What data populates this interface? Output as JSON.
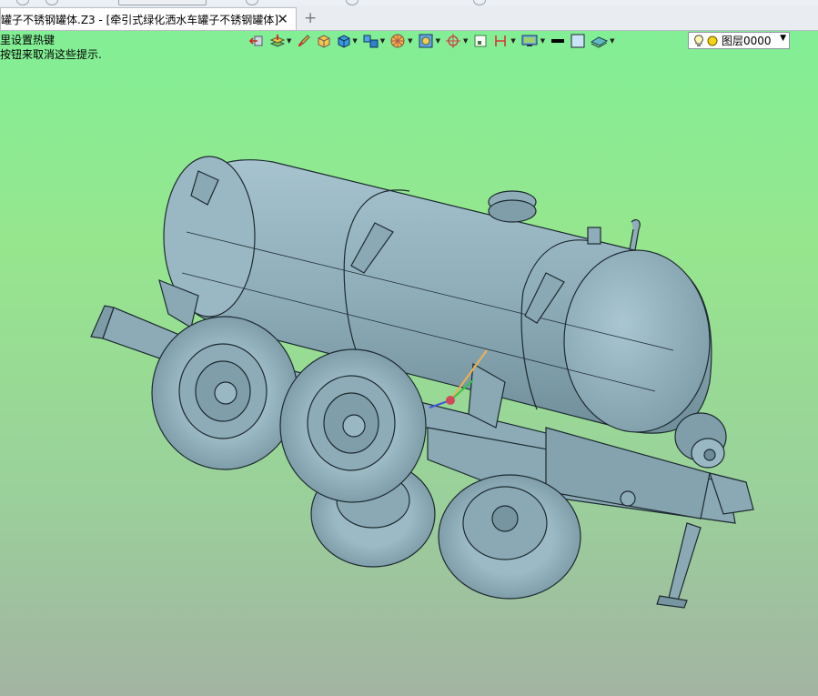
{
  "tab": {
    "title": "罐子不锈钢罐体.Z3 - [牵引式绿化洒水车罐子不锈钢罐体]",
    "close_glyph": "✕",
    "new_glyph": "+"
  },
  "hints": {
    "line1": "里设置热键",
    "line2": "按钮来取消这些提示."
  },
  "layer": {
    "label": "图层0000",
    "arrow": "▼"
  },
  "toolbar": {
    "items": [
      "exit-icon",
      "layers-stack-icon",
      "brush-icon",
      "cube-yellow-icon",
      "cube-blue-icon",
      "cube-group-icon",
      "color-wheel-icon",
      "render-style-icon",
      "crosshair-icon",
      "box-icon",
      "dimension-icon",
      "display-icon",
      "line-color-swatch",
      "fill-swatch",
      "plane-icon",
      "lightbulb-icon",
      "sun-icon"
    ]
  },
  "colors": {
    "background_top": "#7ff096",
    "background_bottom": "#a3b4a2",
    "model": "#8fadb8",
    "model_edge": "#1d2a30"
  }
}
